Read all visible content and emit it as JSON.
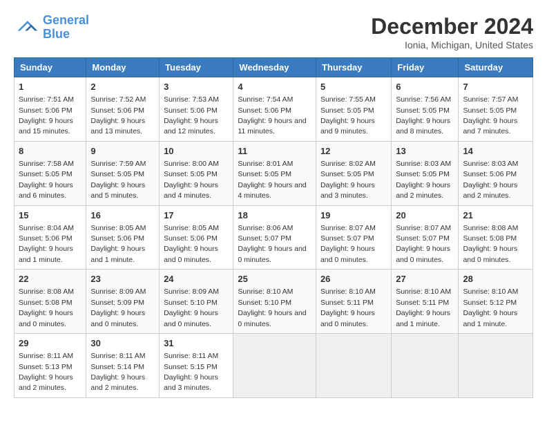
{
  "logo": {
    "line1": "General",
    "line2": "Blue"
  },
  "title": "December 2024",
  "subtitle": "Ionia, Michigan, United States",
  "headers": [
    "Sunday",
    "Monday",
    "Tuesday",
    "Wednesday",
    "Thursday",
    "Friday",
    "Saturday"
  ],
  "weeks": [
    [
      {
        "day": "1",
        "info": "Sunrise: 7:51 AM\nSunset: 5:06 PM\nDaylight: 9 hours and 15 minutes."
      },
      {
        "day": "2",
        "info": "Sunrise: 7:52 AM\nSunset: 5:06 PM\nDaylight: 9 hours and 13 minutes."
      },
      {
        "day": "3",
        "info": "Sunrise: 7:53 AM\nSunset: 5:06 PM\nDaylight: 9 hours and 12 minutes."
      },
      {
        "day": "4",
        "info": "Sunrise: 7:54 AM\nSunset: 5:06 PM\nDaylight: 9 hours and 11 minutes."
      },
      {
        "day": "5",
        "info": "Sunrise: 7:55 AM\nSunset: 5:05 PM\nDaylight: 9 hours and 9 minutes."
      },
      {
        "day": "6",
        "info": "Sunrise: 7:56 AM\nSunset: 5:05 PM\nDaylight: 9 hours and 8 minutes."
      },
      {
        "day": "7",
        "info": "Sunrise: 7:57 AM\nSunset: 5:05 PM\nDaylight: 9 hours and 7 minutes."
      }
    ],
    [
      {
        "day": "8",
        "info": "Sunrise: 7:58 AM\nSunset: 5:05 PM\nDaylight: 9 hours and 6 minutes."
      },
      {
        "day": "9",
        "info": "Sunrise: 7:59 AM\nSunset: 5:05 PM\nDaylight: 9 hours and 5 minutes."
      },
      {
        "day": "10",
        "info": "Sunrise: 8:00 AM\nSunset: 5:05 PM\nDaylight: 9 hours and 4 minutes."
      },
      {
        "day": "11",
        "info": "Sunrise: 8:01 AM\nSunset: 5:05 PM\nDaylight: 9 hours and 4 minutes."
      },
      {
        "day": "12",
        "info": "Sunrise: 8:02 AM\nSunset: 5:05 PM\nDaylight: 9 hours and 3 minutes."
      },
      {
        "day": "13",
        "info": "Sunrise: 8:03 AM\nSunset: 5:05 PM\nDaylight: 9 hours and 2 minutes."
      },
      {
        "day": "14",
        "info": "Sunrise: 8:03 AM\nSunset: 5:06 PM\nDaylight: 9 hours and 2 minutes."
      }
    ],
    [
      {
        "day": "15",
        "info": "Sunrise: 8:04 AM\nSunset: 5:06 PM\nDaylight: 9 hours and 1 minute."
      },
      {
        "day": "16",
        "info": "Sunrise: 8:05 AM\nSunset: 5:06 PM\nDaylight: 9 hours and 1 minute."
      },
      {
        "day": "17",
        "info": "Sunrise: 8:05 AM\nSunset: 5:06 PM\nDaylight: 9 hours and 0 minutes."
      },
      {
        "day": "18",
        "info": "Sunrise: 8:06 AM\nSunset: 5:07 PM\nDaylight: 9 hours and 0 minutes."
      },
      {
        "day": "19",
        "info": "Sunrise: 8:07 AM\nSunset: 5:07 PM\nDaylight: 9 hours and 0 minutes."
      },
      {
        "day": "20",
        "info": "Sunrise: 8:07 AM\nSunset: 5:07 PM\nDaylight: 9 hours and 0 minutes."
      },
      {
        "day": "21",
        "info": "Sunrise: 8:08 AM\nSunset: 5:08 PM\nDaylight: 9 hours and 0 minutes."
      }
    ],
    [
      {
        "day": "22",
        "info": "Sunrise: 8:08 AM\nSunset: 5:08 PM\nDaylight: 9 hours and 0 minutes."
      },
      {
        "day": "23",
        "info": "Sunrise: 8:09 AM\nSunset: 5:09 PM\nDaylight: 9 hours and 0 minutes."
      },
      {
        "day": "24",
        "info": "Sunrise: 8:09 AM\nSunset: 5:10 PM\nDaylight: 9 hours and 0 minutes."
      },
      {
        "day": "25",
        "info": "Sunrise: 8:10 AM\nSunset: 5:10 PM\nDaylight: 9 hours and 0 minutes."
      },
      {
        "day": "26",
        "info": "Sunrise: 8:10 AM\nSunset: 5:11 PM\nDaylight: 9 hours and 0 minutes."
      },
      {
        "day": "27",
        "info": "Sunrise: 8:10 AM\nSunset: 5:11 PM\nDaylight: 9 hours and 1 minute."
      },
      {
        "day": "28",
        "info": "Sunrise: 8:10 AM\nSunset: 5:12 PM\nDaylight: 9 hours and 1 minute."
      }
    ],
    [
      {
        "day": "29",
        "info": "Sunrise: 8:11 AM\nSunset: 5:13 PM\nDaylight: 9 hours and 2 minutes."
      },
      {
        "day": "30",
        "info": "Sunrise: 8:11 AM\nSunset: 5:14 PM\nDaylight: 9 hours and 2 minutes."
      },
      {
        "day": "31",
        "info": "Sunrise: 8:11 AM\nSunset: 5:15 PM\nDaylight: 9 hours and 3 minutes."
      },
      null,
      null,
      null,
      null
    ]
  ]
}
